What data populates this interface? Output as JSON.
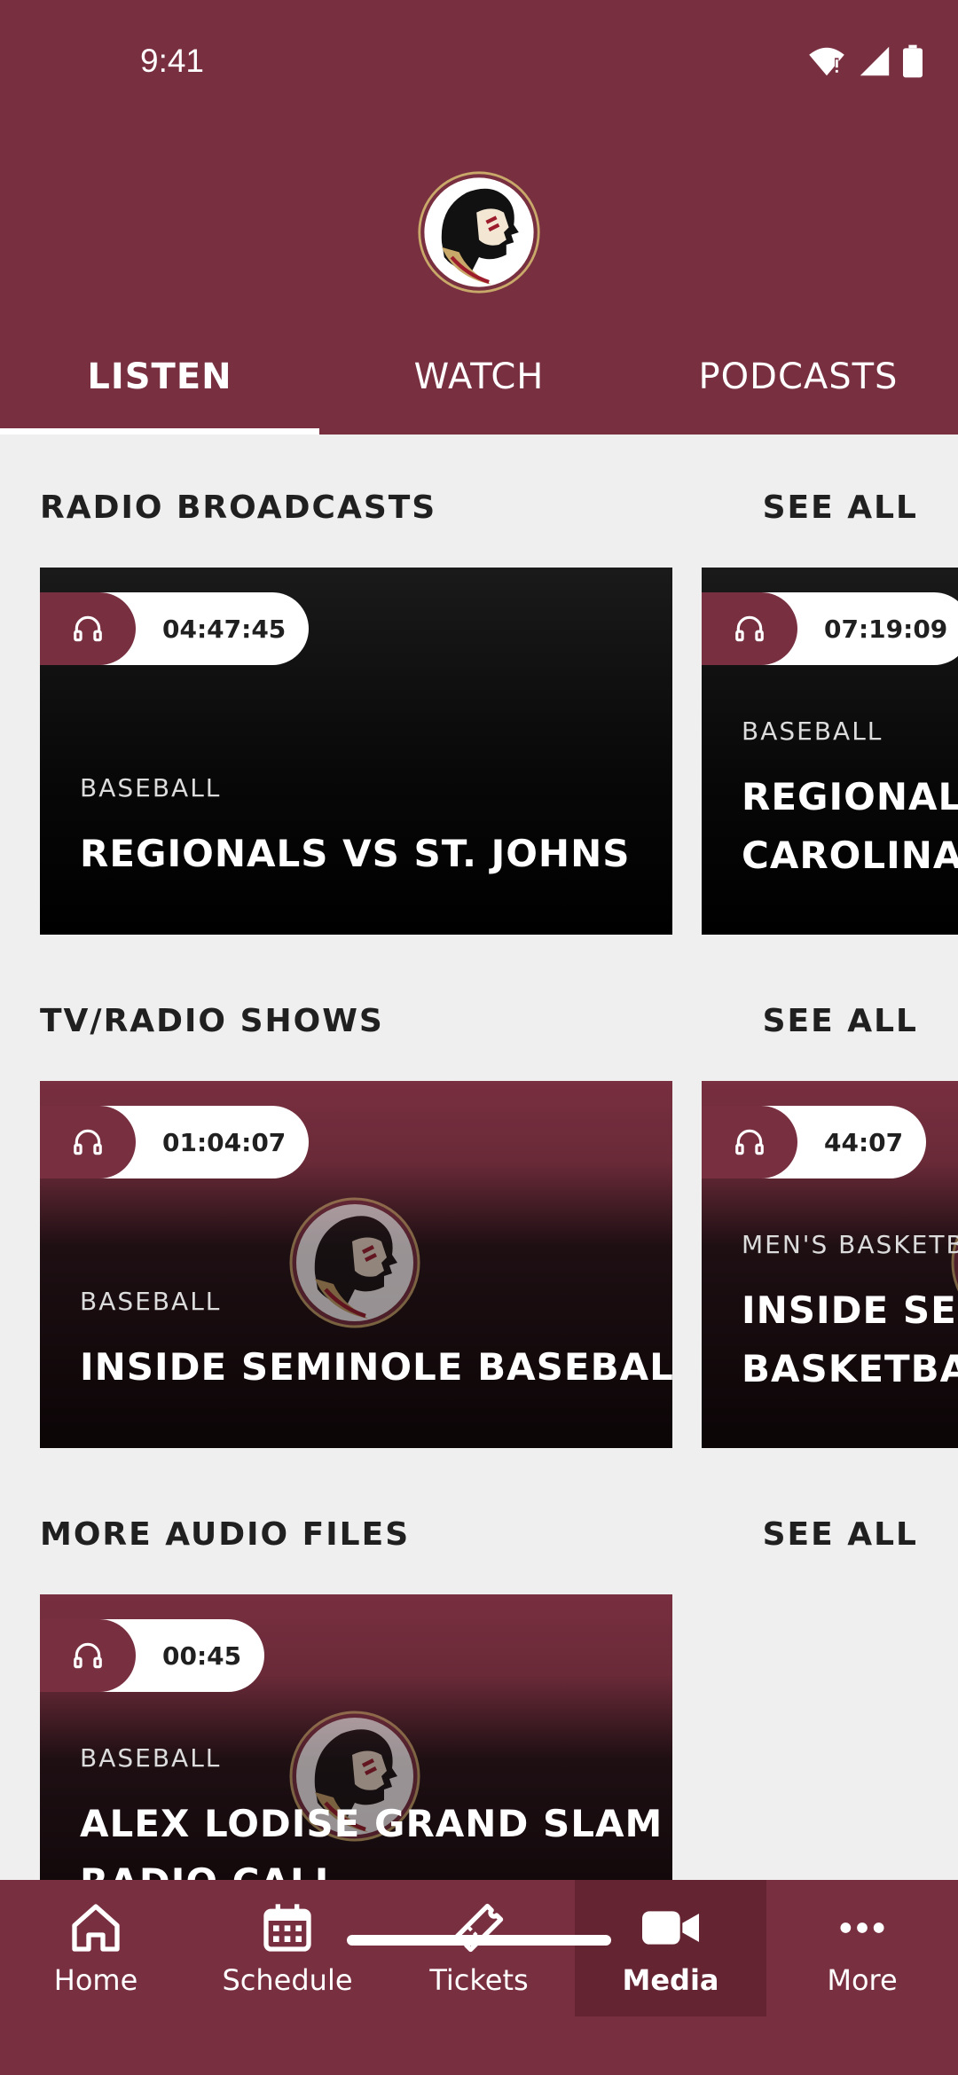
{
  "status_bar": {
    "time": "9:41"
  },
  "tabs": [
    {
      "label": "LISTEN",
      "active": true
    },
    {
      "label": "WATCH",
      "active": false
    },
    {
      "label": "PODCASTS",
      "active": false
    }
  ],
  "sections": {
    "radio": {
      "title": "RADIO BROADCASTS",
      "see_all": "SEE ALL",
      "cards": [
        {
          "duration": "04:47:45",
          "category": "BASEBALL",
          "title_lines": [
            "REGIONALS VS ST. JOHNS"
          ]
        },
        {
          "duration": "07:19:09",
          "category": "BASEBALL",
          "title_lines": [
            "REGIONALS",
            "CAROLINA"
          ]
        }
      ]
    },
    "shows": {
      "title": "TV/RADIO SHOWS",
      "see_all": "SEE ALL",
      "cards": [
        {
          "duration": "01:04:07",
          "category": "BASEBALL",
          "title_lines": [
            "INSIDE SEMINOLE BASEBALL"
          ]
        },
        {
          "duration": "44:07",
          "category": "MEN'S BASKETBA",
          "title_lines": [
            "INSIDE SEMI",
            "BASKETBALL"
          ]
        }
      ]
    },
    "audio": {
      "title": "MORE AUDIO FILES",
      "see_all": "SEE ALL",
      "cards": [
        {
          "duration": "00:45",
          "category": "BASEBALL",
          "title_lines": [
            "ALEX LODISE GRAND SLAM -",
            "RADIO CALL"
          ]
        }
      ]
    }
  },
  "bottom_nav": [
    {
      "label": "Home",
      "icon": "home-icon",
      "active": false
    },
    {
      "label": "Schedule",
      "icon": "calendar-icon",
      "active": false
    },
    {
      "label": "Tickets",
      "icon": "ticket-icon",
      "active": false
    },
    {
      "label": "Media",
      "icon": "video-camera-icon",
      "active": true
    },
    {
      "label": "More",
      "icon": "more-dots-icon",
      "active": false
    }
  ],
  "colors": {
    "brand": "#782f40",
    "active_nav": "#642432",
    "background": "#efefef"
  }
}
